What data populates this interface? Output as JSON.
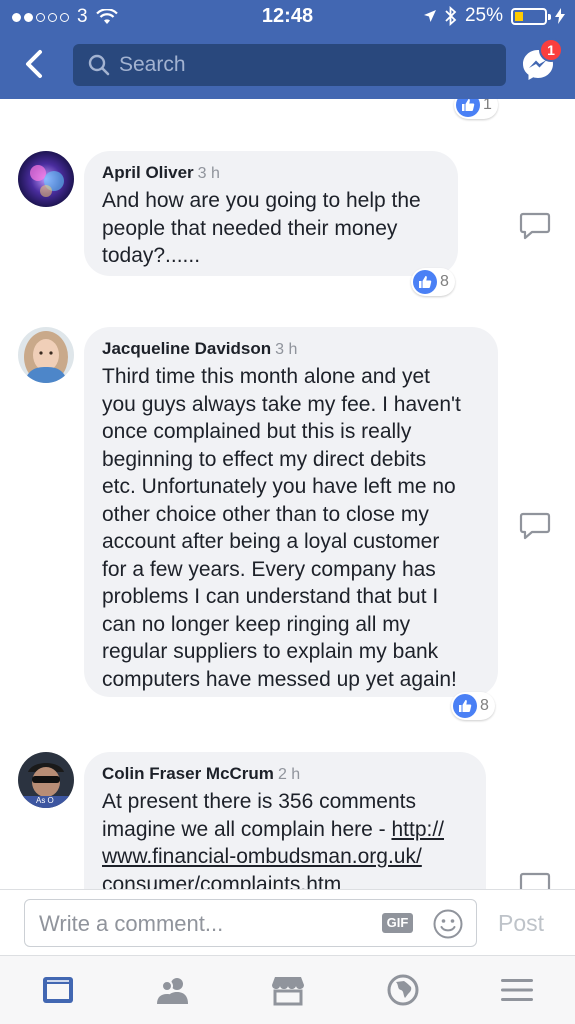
{
  "status_bar": {
    "carrier": "3",
    "time": "12:48",
    "battery": "25%"
  },
  "header": {
    "search_placeholder": "Search",
    "messenger_badge": "1"
  },
  "comments": [
    {
      "author": "April Oliver",
      "time": "3 h",
      "lines": [
        "And how are you going to help the",
        "people that needed their money",
        "today?......"
      ],
      "likes": "8"
    },
    {
      "author": "Jacqueline Davidson",
      "time": "3 h",
      "lines": [
        "Third time this month alone and yet",
        "you guys always take my fee. I haven't",
        "once complained but this is really",
        "beginning to effect my direct debits",
        "etc. Unfortunately you have left me no",
        "other choice other than to close my",
        "account after being a loyal customer",
        "for a few years. Every company has",
        "problems I can understand that but I",
        "can no longer keep ringing all my",
        "regular suppliers to explain my bank",
        "computers have messed up yet again!"
      ],
      "likes": "8"
    },
    {
      "author": "Colin Fraser McCrum",
      "time": "2 h",
      "lines": [
        "At present there is 356 comments",
        "imagine we all complain here - "
      ],
      "link_lines": [
        "http://",
        "www.financial-ombudsman.org.uk/",
        "consumer/complaints.htm"
      ],
      "avatar_text": "As O"
    }
  ],
  "previous_likes": "1",
  "composer": {
    "placeholder": "Write a comment...",
    "gif_label": "GIF",
    "post_label": "Post"
  },
  "colors": {
    "brand": "#4267b2",
    "bubble": "#f1f2f5",
    "like": "#4a80f5"
  }
}
